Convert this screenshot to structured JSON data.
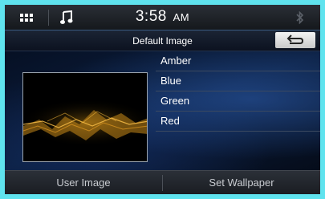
{
  "status": {
    "time": "3:58",
    "ampm": "AM"
  },
  "header": {
    "title": "Default Image"
  },
  "wallpaper_options": [
    {
      "label": "Amber"
    },
    {
      "label": "Blue"
    },
    {
      "label": "Green"
    },
    {
      "label": "Red"
    }
  ],
  "footer": {
    "user_image_label": "User Image",
    "set_wallpaper_label": "Set Wallpaper"
  },
  "colors": {
    "border": "#5fe3ee",
    "preview_accent": "#e8a020",
    "background_glow": "#2e60b4"
  },
  "icons": {
    "menu": "grid-menu-icon",
    "music": "music-note-icon",
    "bluetooth": "bluetooth-icon",
    "back": "back-arrow-icon"
  }
}
